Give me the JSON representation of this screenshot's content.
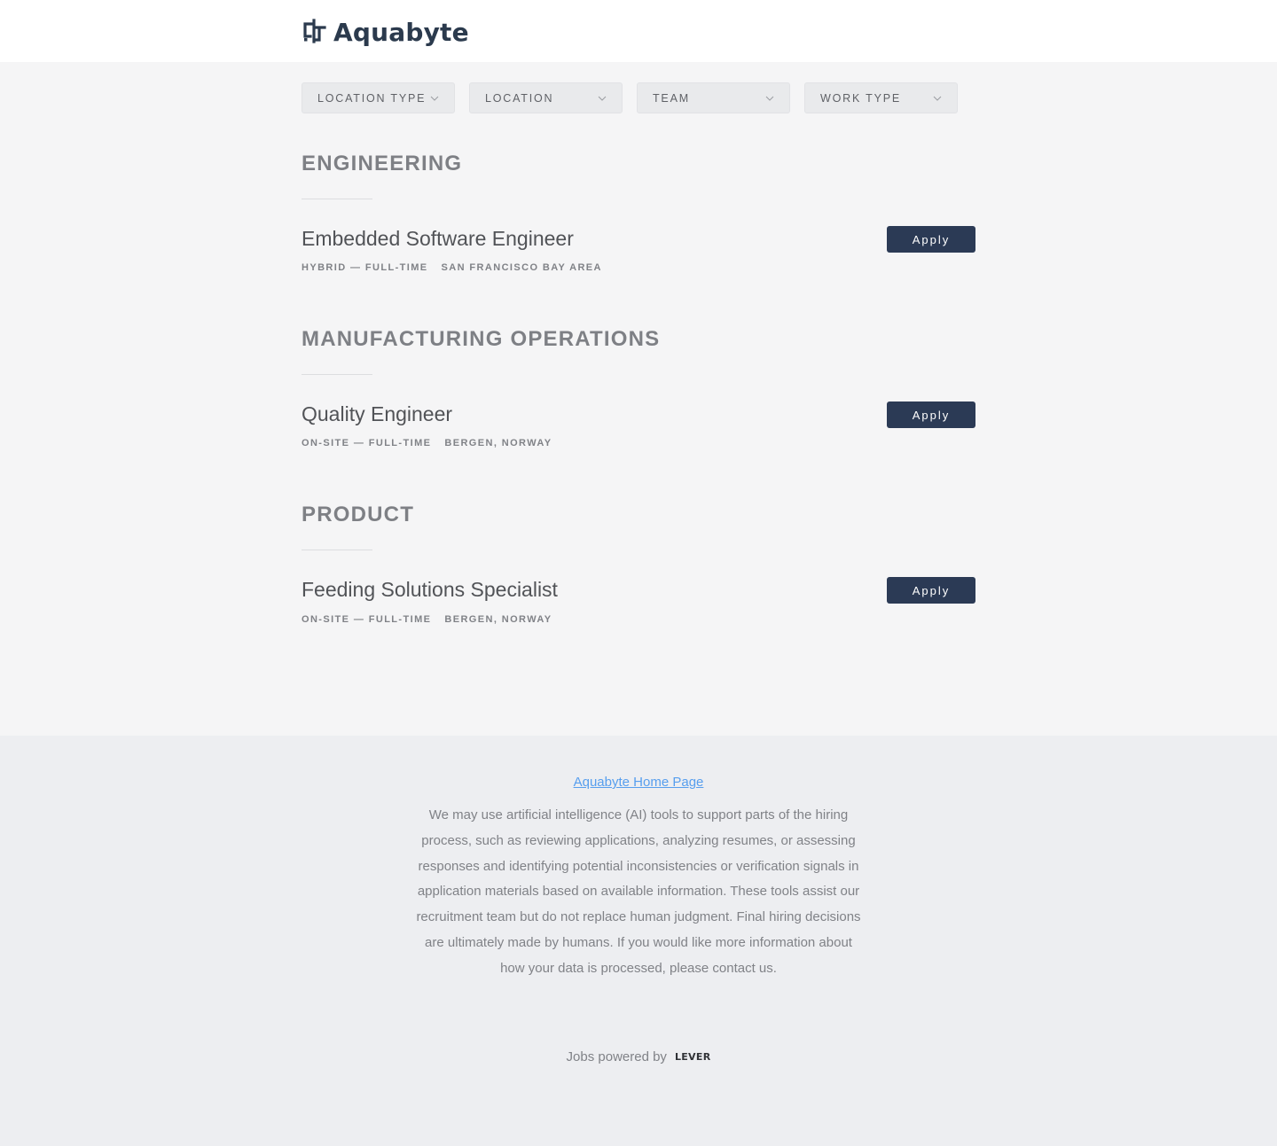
{
  "brand": {
    "name": "Aquabyte",
    "logo_icon": "aquabyte-logo-icon",
    "color": "#2b3a4d"
  },
  "filters": [
    {
      "label": "Location type",
      "icon": "chevron-down-icon"
    },
    {
      "label": "Location",
      "icon": "chevron-down-icon"
    },
    {
      "label": "Team",
      "icon": "chevron-down-icon"
    },
    {
      "label": "Work type",
      "icon": "chevron-down-icon"
    }
  ],
  "groups": [
    {
      "title": "Engineering",
      "postings": [
        {
          "title": "Embedded Software Engineer",
          "commitment": "Hybrid — Full-time",
          "location": "San Francisco Bay Area",
          "apply_label": "Apply"
        }
      ]
    },
    {
      "title": "Manufacturing Operations",
      "postings": [
        {
          "title": "Quality Engineer",
          "commitment": "On-site — Full-time",
          "location": "Bergen, Norway",
          "apply_label": "Apply"
        }
      ]
    },
    {
      "title": "Product",
      "postings": [
        {
          "title": "Feeding Solutions Specialist",
          "commitment": "On-site — Full-time",
          "location": "Bergen, Norway",
          "apply_label": "Apply"
        }
      ]
    }
  ],
  "footer": {
    "home_link": "Aquabyte Home Page",
    "disclaimer": "We may use artificial intelligence (AI) tools to support parts of the hiring process, such as reviewing applications, analyzing resumes, or assessing responses and identifying potential inconsistencies or verification signals in application materials based on available information. These tools assist our recruitment team but do not replace human judgment. Final hiring decisions are ultimately made by humans. If you would like more information about how your data is processed, please contact us.",
    "powered_by": "Jobs powered by",
    "powered_brand": "LEVER"
  },
  "colors": {
    "apply_button": "#2b3a55",
    "link": "#579eee",
    "page_bg": "#f5f5f6",
    "footer_bg": "#edeef1"
  }
}
